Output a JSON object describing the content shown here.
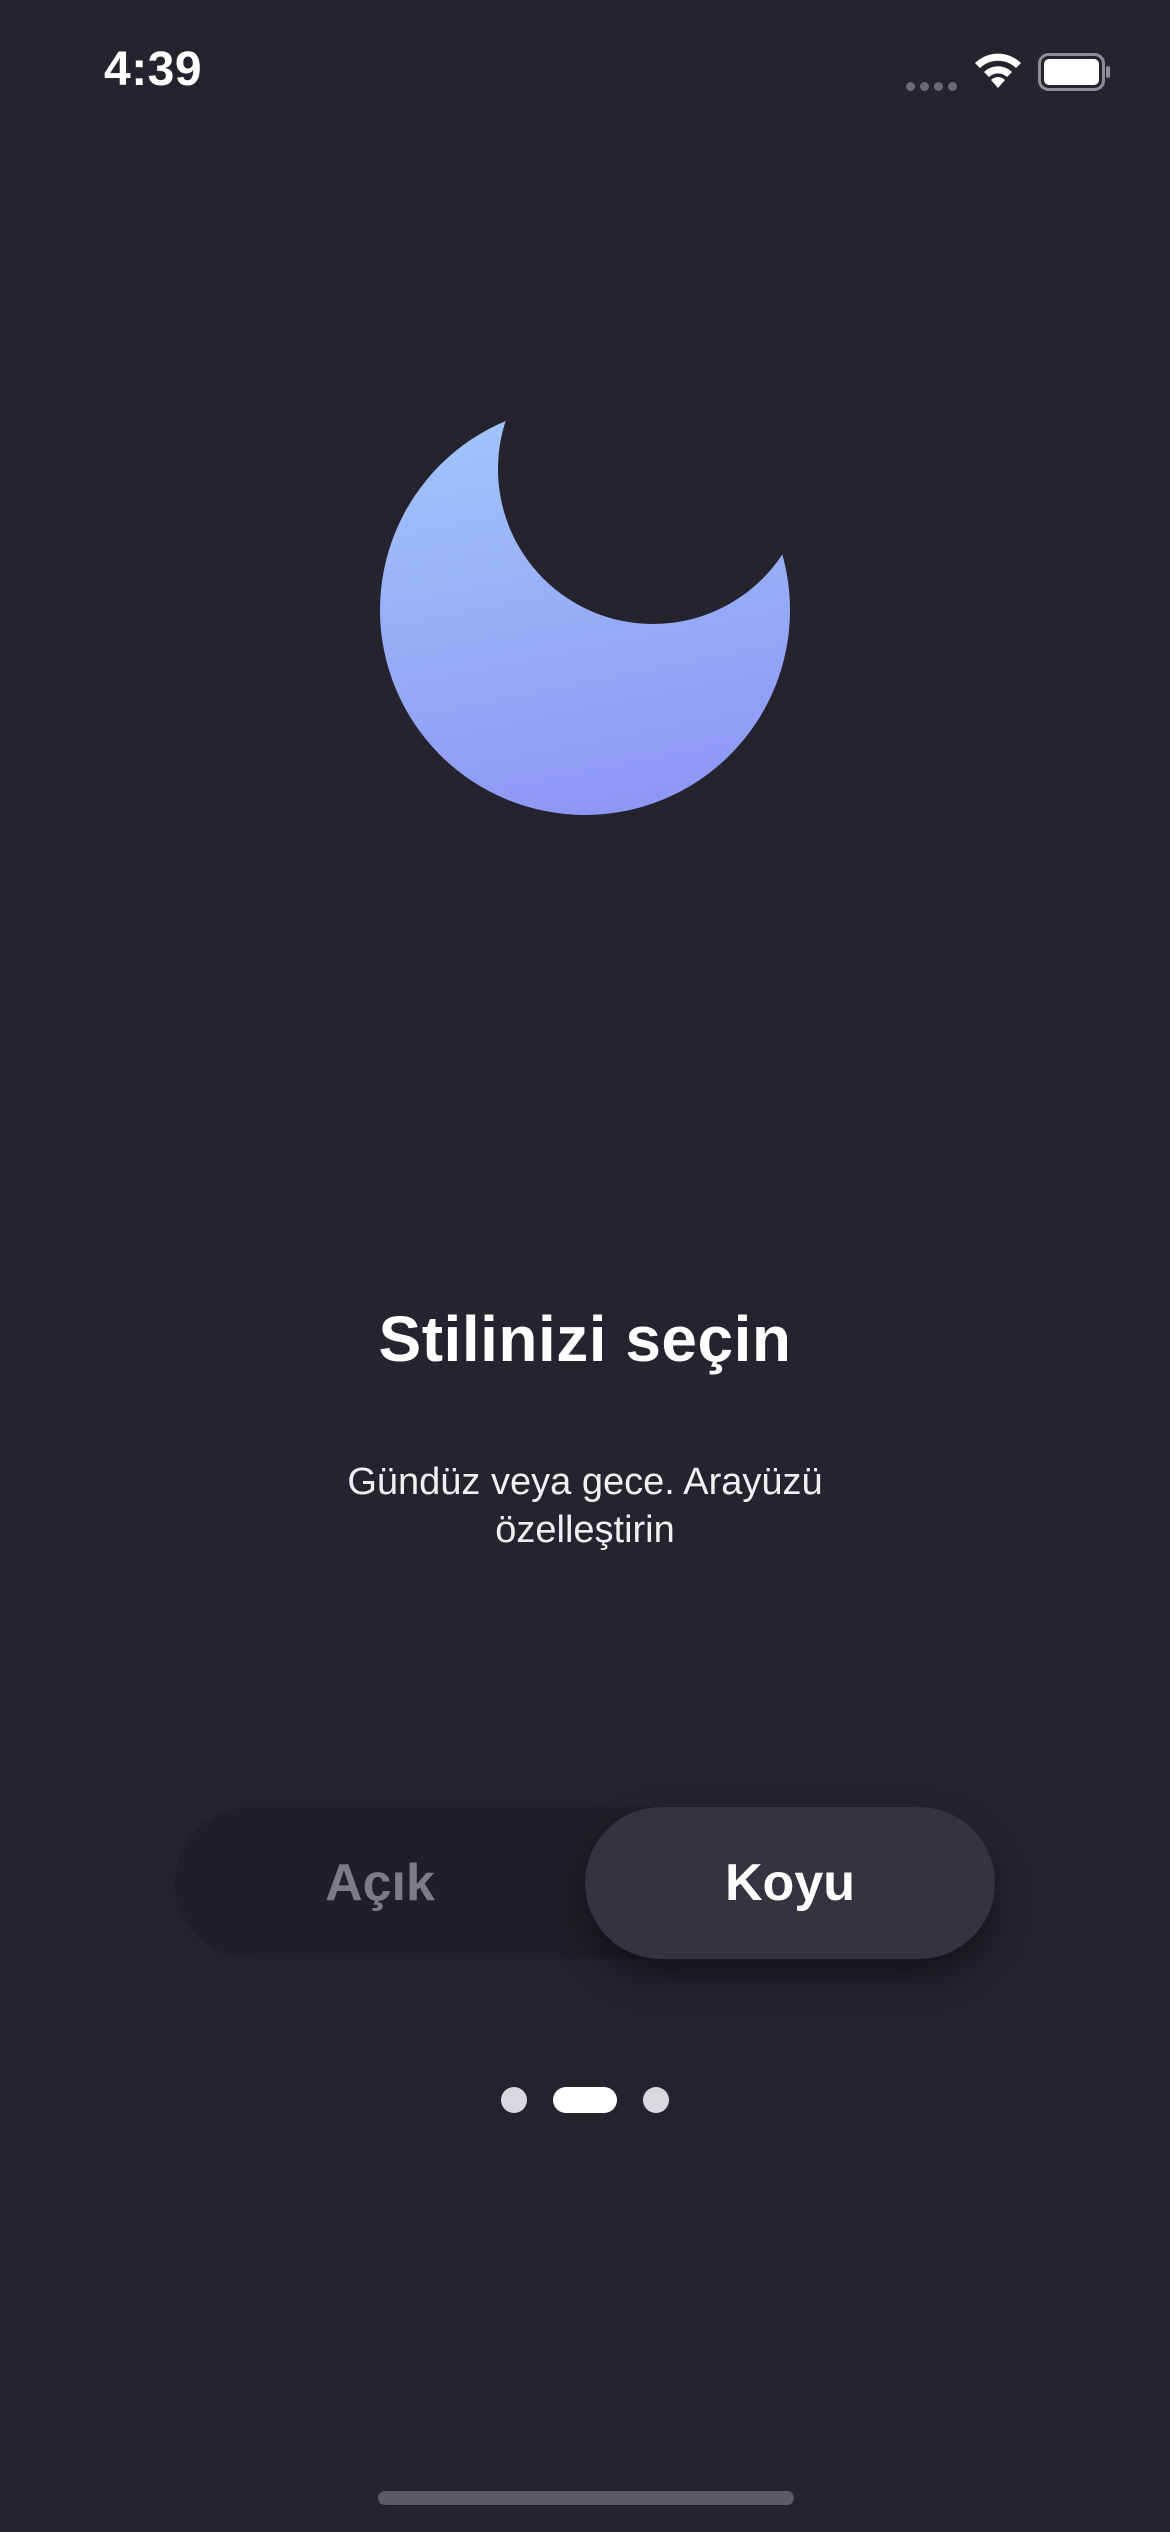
{
  "status_bar": {
    "time": "4:39",
    "icons": [
      "cellular-signal-icon",
      "wifi-icon",
      "battery-icon"
    ]
  },
  "hero": {
    "icon": "moon-icon",
    "gradient_top": "#a2c4fb",
    "gradient_bottom": "#8d97f4"
  },
  "onboarding": {
    "title": "Stilinizi seçin",
    "subtitle": "Gündüz veya gece. Arayüzü özelleştirin"
  },
  "theme_selector": {
    "options": [
      {
        "label": "Açık",
        "selected": false
      },
      {
        "label": "Koyu",
        "selected": true
      }
    ]
  },
  "pager": {
    "total": 3,
    "current": 2
  },
  "colors": {
    "background": "#25242e",
    "selected_segment": "#34333f",
    "unselected_text": "#7d7c85"
  }
}
